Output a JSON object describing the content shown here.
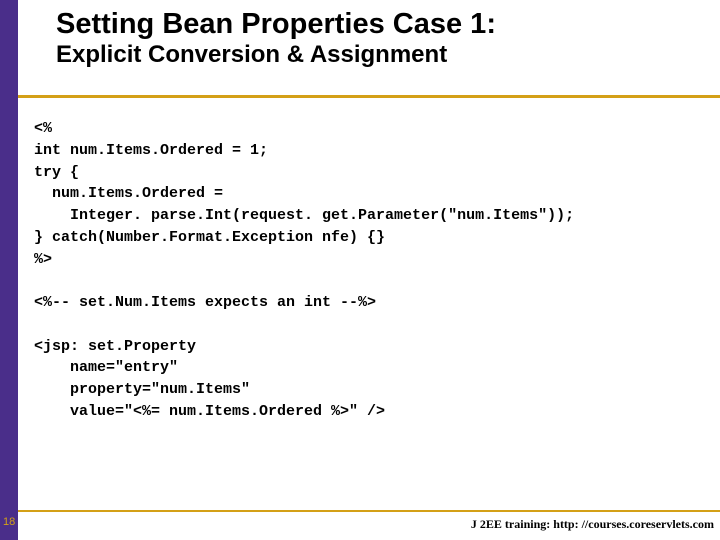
{
  "header": {
    "title": "Setting Bean Properties Case 1:",
    "subtitle": "Explicit Conversion & Assignment"
  },
  "code": {
    "block": "<%\nint num.Items.Ordered = 1;\ntry {\n  num.Items.Ordered =\n    Integer. parse.Int(request. get.Parameter(\"num.Items\"));\n} catch(Number.Format.Exception nfe) {}\n%>\n\n<%-- set.Num.Items expects an int --%>\n\n<jsp: set.Property\n    name=\"entry\"\n    property=\"num.Items\"\n    value=\"<%= num.Items.Ordered %>\" />"
  },
  "footer": {
    "page": "18",
    "text": "J 2EE training: http: //courses.coreservlets.com"
  }
}
